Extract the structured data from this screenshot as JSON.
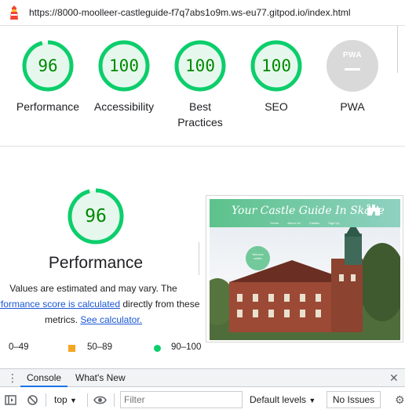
{
  "address": {
    "url": "https://8000-moolleer-castleguide-f7q7abs1o9m.ws-eu77.gitpod.io/index.html"
  },
  "gauges": [
    {
      "score": "96",
      "label": "Performance"
    },
    {
      "score": "100",
      "label": "Accessibility"
    },
    {
      "score": "100",
      "label": "Best Practices"
    },
    {
      "score": "100",
      "label": "SEO"
    },
    {
      "badge": "PWA",
      "label": "PWA"
    }
  ],
  "performance": {
    "score": "96",
    "title": "Performance",
    "desc_1": "Values are estimated and may vary. The",
    "link_score": "performance score is calculated",
    "desc_2": "directly from these",
    "desc_3": "metrics.",
    "link_calc": "See calculator."
  },
  "legend": [
    {
      "range": "0–49",
      "color": "#ff4e42"
    },
    {
      "range": "50–89",
      "color": "#ffa400"
    },
    {
      "range": "90–100",
      "color": "#0cce6b"
    }
  ],
  "screenshot": {
    "site_title": "Your Castle Guide In Skåne",
    "nav": [
      "Home",
      "About Us",
      "Castles",
      "Sign Up"
    ]
  },
  "devtools": {
    "tabs": [
      "Console",
      "What's New"
    ],
    "context": "top",
    "filter_placeholder": "Filter",
    "levels": "Default levels",
    "issues": "No Issues"
  },
  "colors": {
    "pass": "#0cce6b",
    "pass_text": "#008800",
    "pwa_gray": "#d9d9d9",
    "link": "#1a56d6"
  }
}
